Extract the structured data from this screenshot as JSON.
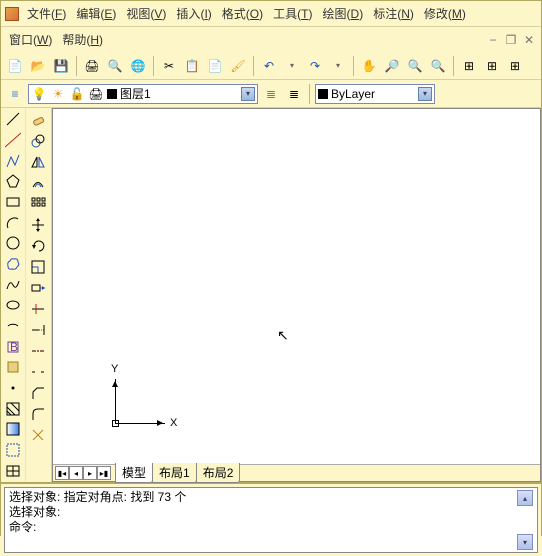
{
  "menu": {
    "items": [
      {
        "label": "文件",
        "key": "F"
      },
      {
        "label": "编辑",
        "key": "E"
      },
      {
        "label": "视图",
        "key": "V"
      },
      {
        "label": "插入",
        "key": "I"
      },
      {
        "label": "格式",
        "key": "O"
      },
      {
        "label": "工具",
        "key": "T"
      },
      {
        "label": "绘图",
        "key": "D"
      },
      {
        "label": "标注",
        "key": "N"
      },
      {
        "label": "修改",
        "key": "M"
      }
    ],
    "items2": [
      {
        "label": "窗口",
        "key": "W"
      },
      {
        "label": "帮助",
        "key": "H"
      }
    ]
  },
  "layer": {
    "current_name": "图层1",
    "bylayer": "ByLayer"
  },
  "axes": {
    "x": "X",
    "y": "Y"
  },
  "tabs": {
    "model": "模型",
    "layout1": "布局1",
    "layout2": "布局2"
  },
  "command": {
    "line1": "选择对象: 指定对角点: 找到 73 个",
    "line2": "选择对象:",
    "prompt": "命令:"
  }
}
